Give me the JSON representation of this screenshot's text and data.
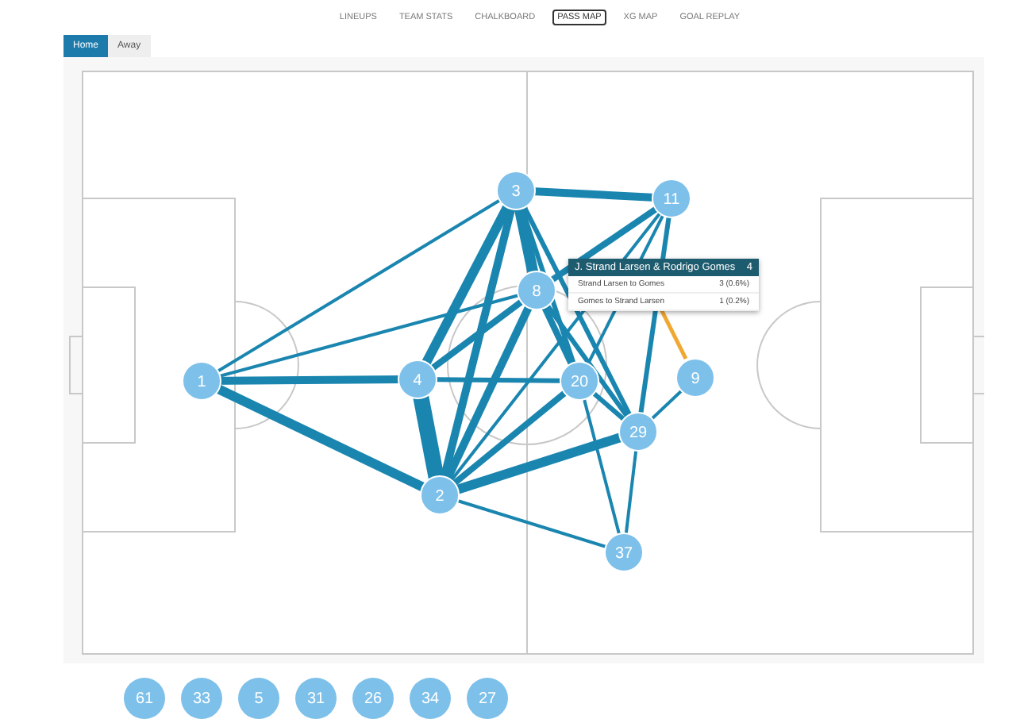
{
  "nav": [
    {
      "label": "LINEUPS",
      "selected": false
    },
    {
      "label": "TEAM STATS",
      "selected": false
    },
    {
      "label": "CHALKBOARD",
      "selected": false
    },
    {
      "label": "PASS MAP",
      "selected": true
    },
    {
      "label": "XG MAP",
      "selected": false
    },
    {
      "label": "GOAL REPLAY",
      "selected": false
    }
  ],
  "tabs": [
    {
      "label": "Home",
      "selected": true
    },
    {
      "label": "Away",
      "selected": false
    }
  ],
  "players": [
    {
      "number": "1"
    },
    {
      "number": "3"
    },
    {
      "number": "11"
    },
    {
      "number": "8"
    },
    {
      "number": "4"
    },
    {
      "number": "20"
    },
    {
      "number": "9"
    },
    {
      "number": "29"
    },
    {
      "number": "2"
    },
    {
      "number": "37"
    }
  ],
  "tooltip": {
    "title": "J. Strand Larsen & Rodrigo Gomes",
    "count": "4",
    "rows": [
      {
        "label": "Strand Larsen to Gomes",
        "value": "3 (0.6%)"
      },
      {
        "label": "Gomes to Strand Larsen",
        "value": "1 (0.2%)"
      }
    ]
  },
  "bench": [
    {
      "number": "61"
    },
    {
      "number": "33"
    },
    {
      "number": "5"
    },
    {
      "number": "31"
    },
    {
      "number": "26"
    },
    {
      "number": "34"
    },
    {
      "number": "27"
    }
  ]
}
